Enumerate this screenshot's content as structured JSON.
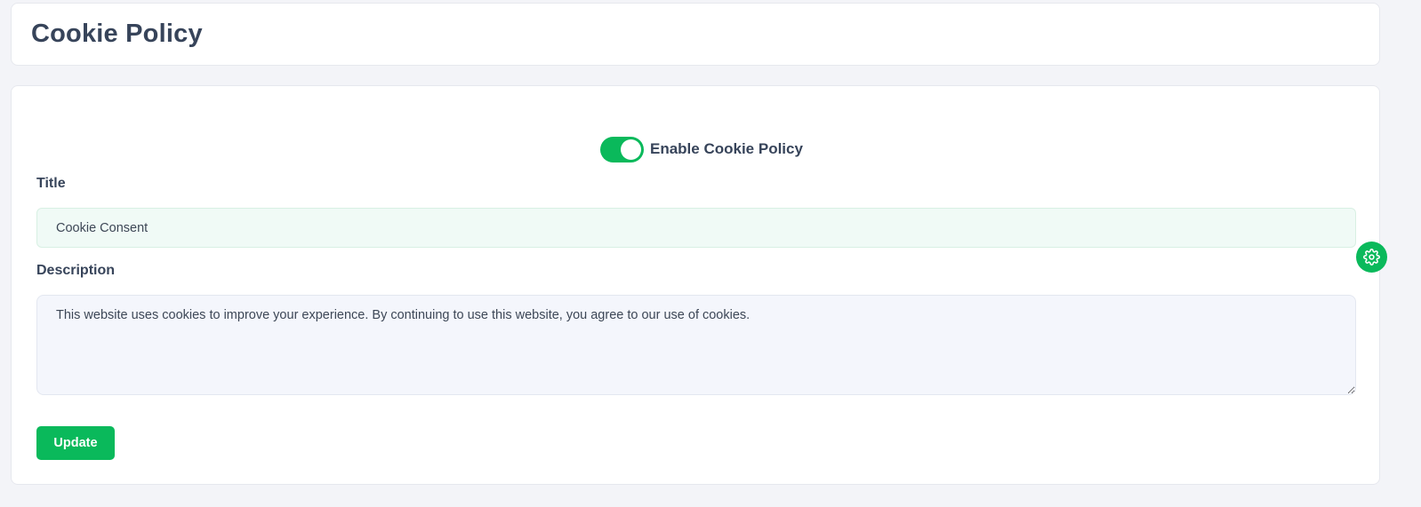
{
  "header": {
    "title": "Cookie Policy"
  },
  "form": {
    "toggle": {
      "label": "Enable Cookie Policy",
      "enabled": true
    },
    "title_label": "Title",
    "title_value": "Cookie Consent",
    "description_label": "Description",
    "description_value": "This website uses cookies to improve your experience. By continuing to use this website, you agree to our use of cookies.",
    "update_label": "Update"
  },
  "icons": {
    "settings_fab": "gear-icon"
  },
  "colors": {
    "accent": "#0ab95b",
    "title_text": "#37445a",
    "page_background": "#f3f4f8",
    "title_input_bg": "#f0faf6",
    "textarea_bg": "#f4f6fc"
  }
}
